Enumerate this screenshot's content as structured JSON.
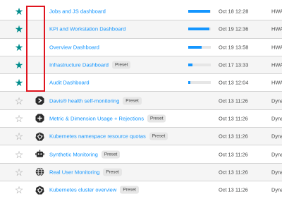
{
  "dashboards": [
    {
      "favorite": true,
      "icon": "none",
      "name": "Jobs and JS dashboard",
      "preset": "",
      "usage": 0.97,
      "date": "Oct 18 12:28",
      "owner": "HWA"
    },
    {
      "favorite": true,
      "icon": "none",
      "name": "KPI and Workstation Dashboard",
      "preset": "",
      "usage": 0.94,
      "date": "Oct 19 12:36",
      "owner": "HWA"
    },
    {
      "favorite": true,
      "icon": "none",
      "name": "Overview Dashboard",
      "preset": "",
      "usage": 0.6,
      "date": "Oct 19 13:58",
      "owner": "HWA"
    },
    {
      "favorite": true,
      "icon": "none",
      "name": "Infrastructure Dashboard",
      "preset": "Preset",
      "usage": 0.2,
      "date": "Oct 17 13:33",
      "owner": "HWA"
    },
    {
      "favorite": true,
      "icon": "none",
      "name": "Audit Dashboard",
      "preset": "",
      "usage": 0.1,
      "date": "Oct 13 12:04",
      "owner": "HWA"
    },
    {
      "favorite": false,
      "icon": "davis-icon",
      "name": "Davis® health self-monitoring",
      "preset": "Preset",
      "usage": 0,
      "date": "Oct 13 11:26",
      "owner": "Dyna"
    },
    {
      "favorite": false,
      "icon": "metrics-icon",
      "name": "Metric & Dimension Usage + Rejections",
      "preset": "Preset",
      "usage": 0,
      "date": "Oct 13 11:26",
      "owner": "Dyna"
    },
    {
      "favorite": false,
      "icon": "kubernetes-icon",
      "name": "Kubernetes namespace resource quotas",
      "preset": "Preset",
      "usage": 0,
      "date": "Oct 13 11:26",
      "owner": "Dyna"
    },
    {
      "favorite": false,
      "icon": "robot-icon",
      "name": "Synthetic Monitoring",
      "preset": "Preset",
      "usage": 0,
      "date": "Oct 13 11:26",
      "owner": "Dyna"
    },
    {
      "favorite": false,
      "icon": "globe-icon",
      "name": "Real User Monitoring",
      "preset": "Preset",
      "usage": 0,
      "date": "Oct 13 11:26",
      "owner": "Dyna"
    },
    {
      "favorite": false,
      "icon": "kubernetes-icon",
      "name": "Kubernetes cluster overview",
      "preset": "Preset",
      "usage": 0,
      "date": "Oct 13 11:26",
      "owner": "Dyna"
    }
  ],
  "colors": {
    "accent": "#1496ff",
    "favorite": "#008c8c",
    "highlight": "#e0141e"
  }
}
